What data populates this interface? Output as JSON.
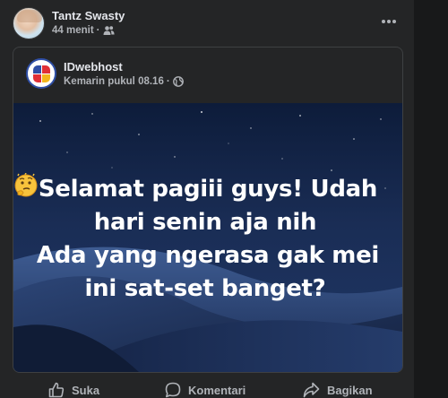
{
  "post": {
    "author": "Tantz Swasty",
    "time": "44 menit",
    "separator": "·"
  },
  "shared": {
    "page_name": "IDwebhost",
    "time": "Kemarin pukul 08.16",
    "separator": "·"
  },
  "image_caption": {
    "line1": "Selamat pagiii guys! Udah",
    "line2": "hari senin aja nih",
    "line3": "Ada yang ngerasa gak mei",
    "line4": "ini sat-set banget?"
  },
  "actions": {
    "like": "Suka",
    "comment": "Komentari",
    "share": "Bagikan"
  },
  "colors": {
    "background": "#18191a",
    "card": "#242526",
    "text_primary": "#e4e6eb",
    "text_secondary": "#b0b3b8"
  },
  "icons": {
    "audience": "friends-icon",
    "globe": "globe-icon",
    "more": "more-horizontal-icon",
    "like": "thumbs-up-icon",
    "comment": "comment-icon",
    "share": "share-icon"
  }
}
